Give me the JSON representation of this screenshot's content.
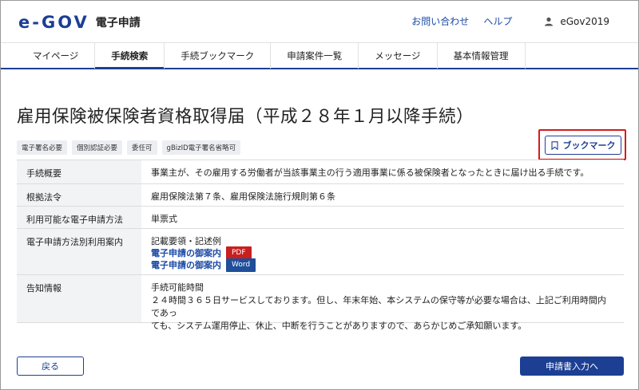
{
  "header": {
    "logo_text": "e-GOV",
    "logo_subtitle": "電子申請",
    "links": [
      "お問い合わせ",
      "ヘルプ"
    ],
    "user_name": "eGov2019"
  },
  "nav": {
    "tabs": [
      {
        "label": "マイページ",
        "active": false
      },
      {
        "label": "手続検索",
        "active": true
      },
      {
        "label": "手続ブックマーク",
        "active": false
      },
      {
        "label": "申請案件一覧",
        "active": false
      },
      {
        "label": "メッセージ",
        "active": false
      },
      {
        "label": "基本情報管理",
        "active": false
      }
    ]
  },
  "page": {
    "title": "雇用保険被保険者資格取得届（平成２８年１月以降手続）",
    "tags": [
      "電子署名必要",
      "個別認証必要",
      "委任可",
      "gBizID電子署名省略可"
    ],
    "bookmark_label": "ブックマーク"
  },
  "details": {
    "rows": [
      {
        "label": "手続概要",
        "value": "事業主が、その雇用する労働者が当該事業主の行う適用事業に係る被保険者となったときに届け出る手続です。"
      },
      {
        "label": "根拠法令",
        "value": "雇用保険法第７条、雇用保険法施行規則第６条"
      },
      {
        "label": "利用可能な電子申請方法",
        "value": "単票式"
      },
      {
        "label": "電子申請方法別利用案内",
        "value": "記載要領・記述例"
      },
      {
        "label": "告知情報",
        "value": "手続可能時間"
      }
    ],
    "guide_links": [
      {
        "text": "電子申請の御案内",
        "badge": "PDF"
      },
      {
        "text": "電子申請の御案内",
        "badge": "Word"
      }
    ],
    "notice_line1": "２４時間３６５日サービスしております。但し、年末年始、本システムの保守等が必要な場合は、上記ご利用時間内であっ",
    "notice_line2": "ても、システム運用停止、休止、中断を行うことがありますので、あらかじめご承知願います。"
  },
  "footer": {
    "back_label": "戻る",
    "apply_label": "申請書入力へ"
  },
  "colors": {
    "brand": "#1c3f94",
    "highlight": "#d21d1d",
    "pdf_badge": "#c81f1f",
    "word_badge": "#1f4e9a"
  }
}
